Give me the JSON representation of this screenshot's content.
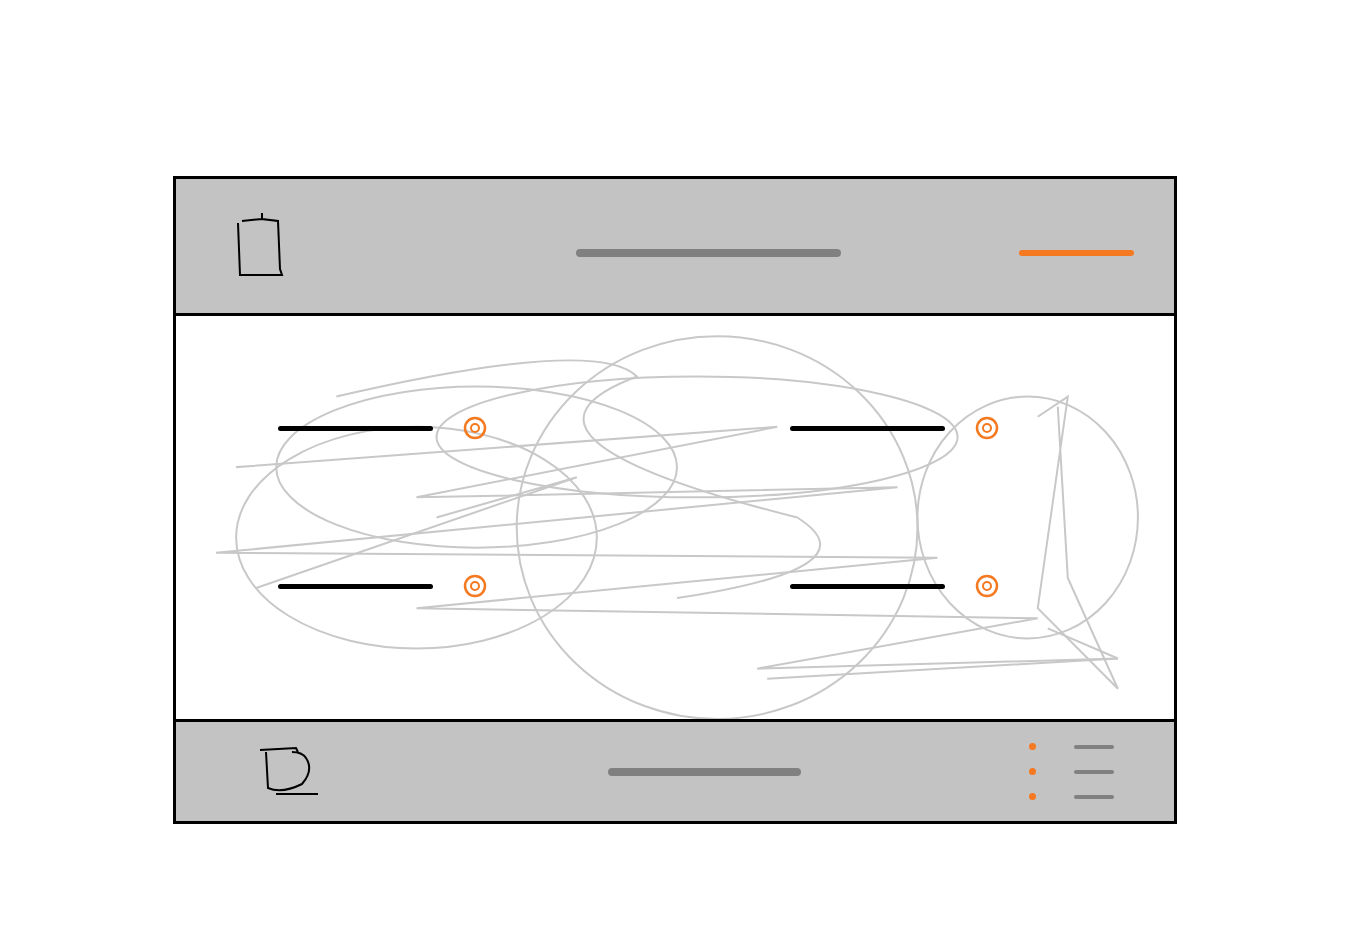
{
  "header": {
    "icon": "page",
    "title_placeholder": true,
    "action_placeholder": true
  },
  "main": {
    "background": "scribble",
    "items": [
      {
        "kind": "line-with-icon"
      },
      {
        "kind": "line-with-icon"
      },
      {
        "kind": "line-with-icon"
      },
      {
        "kind": "line-with-icon"
      }
    ]
  },
  "footer": {
    "icon": "cup",
    "title_placeholder": true,
    "menu": [
      {
        "kind": "dot-line"
      },
      {
        "kind": "dot-line"
      },
      {
        "kind": "dot-line"
      }
    ]
  }
}
